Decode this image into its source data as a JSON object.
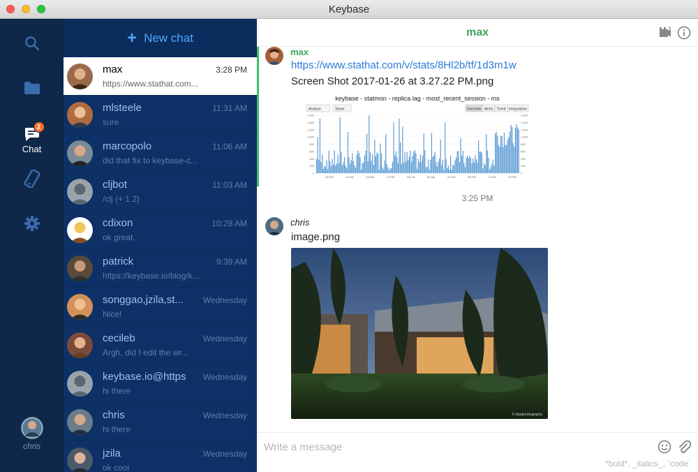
{
  "window": {
    "title": "Keybase"
  },
  "nav": {
    "chat_label": "Chat",
    "chat_badge": "2",
    "user_name": "chris",
    "colors": {
      "background": "#0f2749",
      "icon": "#3b6dad",
      "active": "#ffffff",
      "badge": "#ff6f21"
    }
  },
  "inbox": {
    "new_chat_label": "New chat",
    "conversations": [
      {
        "name": "max",
        "time": "3:28 PM",
        "snippet": "https://www.stathat.com...",
        "selected": true
      },
      {
        "name": "mlsteele",
        "time": "11:31 AM",
        "snippet": "sure"
      },
      {
        "name": "marcopolo",
        "time": "11:06 AM",
        "snippet": "did that fix to keybase-c..."
      },
      {
        "name": "cljbot",
        "time": "11:03 AM",
        "snippet": "/clj (+ 1 2)"
      },
      {
        "name": "cdixon",
        "time": "10:28 AM",
        "snippet": "ok great."
      },
      {
        "name": "patrick",
        "time": "9:39 AM",
        "snippet": "https://keybase.io/blog/k..."
      },
      {
        "name": "songgao,jzila,st...",
        "time": "Wednesday",
        "snippet": "Nice!"
      },
      {
        "name": "cecileb",
        "time": "Wednesday",
        "snippet": "Argh, did I edit the wr..."
      },
      {
        "name": "keybase.io@https",
        "time": "Wednesday",
        "snippet": "hi there"
      },
      {
        "name": "chris",
        "time": "Wednesday",
        "snippet": "hi there"
      },
      {
        "name": "jzila",
        "time": "Wednesday",
        "snippet": "ok cool"
      }
    ]
  },
  "conversation": {
    "title": "max",
    "messages": [
      {
        "author": "max",
        "link": "https://www.stathat.com/v/stats/8Hl2b/tf/1d3m1w",
        "text": "Screen Shot 2017-01-26 at 3.27.22 PM.png",
        "attachment": {
          "chart_title": "keybase - statmon - replica lag - most_recent_session - ms",
          "buttons": [
            "Analyze",
            "Share"
          ],
          "tabs": [
            "Overview",
            "Alerts",
            "Trend",
            "Integrations"
          ],
          "y_ticks": [
            "1,600",
            "1,400",
            "1,200",
            "1,000",
            "800",
            "600",
            "400",
            "200",
            "0"
          ],
          "x_ticks": [
            "06 PM",
            "12 AM",
            "06 AM",
            "12 PM",
            "Thu 26",
            "06 AM",
            "12 PM",
            "06 PM",
            "12 PM",
            "03 PM"
          ]
        }
      },
      {
        "timestamp": "3:25 PM"
      },
      {
        "author": "chris",
        "text": "image.png",
        "attachment": {
          "kind": "photo",
          "credit": "© kbadphotography"
        }
      }
    ],
    "author_colors": {
      "max": "#3fa55b",
      "chris": "#222222"
    }
  },
  "composer": {
    "placeholder": "Write a message",
    "hint": "*bold*, _italics_, `code`"
  }
}
